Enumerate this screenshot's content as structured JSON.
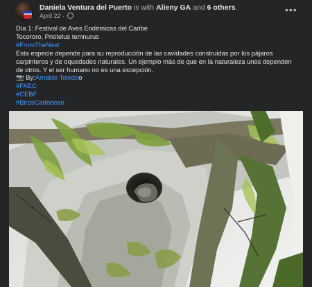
{
  "post": {
    "author": "Daniela Ventura del Puerto",
    "is_with_text": "is with",
    "tagged": "Alieny GA",
    "and_text": "and",
    "others": "6 others",
    "date": "April 22",
    "separator": "·",
    "more_icon": "•••",
    "lines": {
      "l1": "Día 1: Festival de Aves Endémicas del Caribe",
      "l2": "Tocororo, Priotelus temnurus",
      "l3": "#FromTheNest",
      "l4": "Esta especie depende para su reproducción de las cavidades construidas por los pájaros carpinteros y de oquedades naturales. Un ejemplo más de que en la naturaleza unos dependen de otros. Y el ser humano no es una excepción.",
      "l5_prefix": "📷 By:",
      "l5_link": "Arnaldo Toledo",
      "l5_suffix": "o",
      "l6": "#FAEC",
      "l7": "#CEBF",
      "l8": "#BirdsCaribbean"
    }
  },
  "colors": {
    "background": "#242526",
    "text": "#e4e6eb",
    "muted": "#b0b3b8",
    "link": "#4599ff"
  },
  "icons": [
    "avatar",
    "globe-icon",
    "more-options-icon"
  ]
}
